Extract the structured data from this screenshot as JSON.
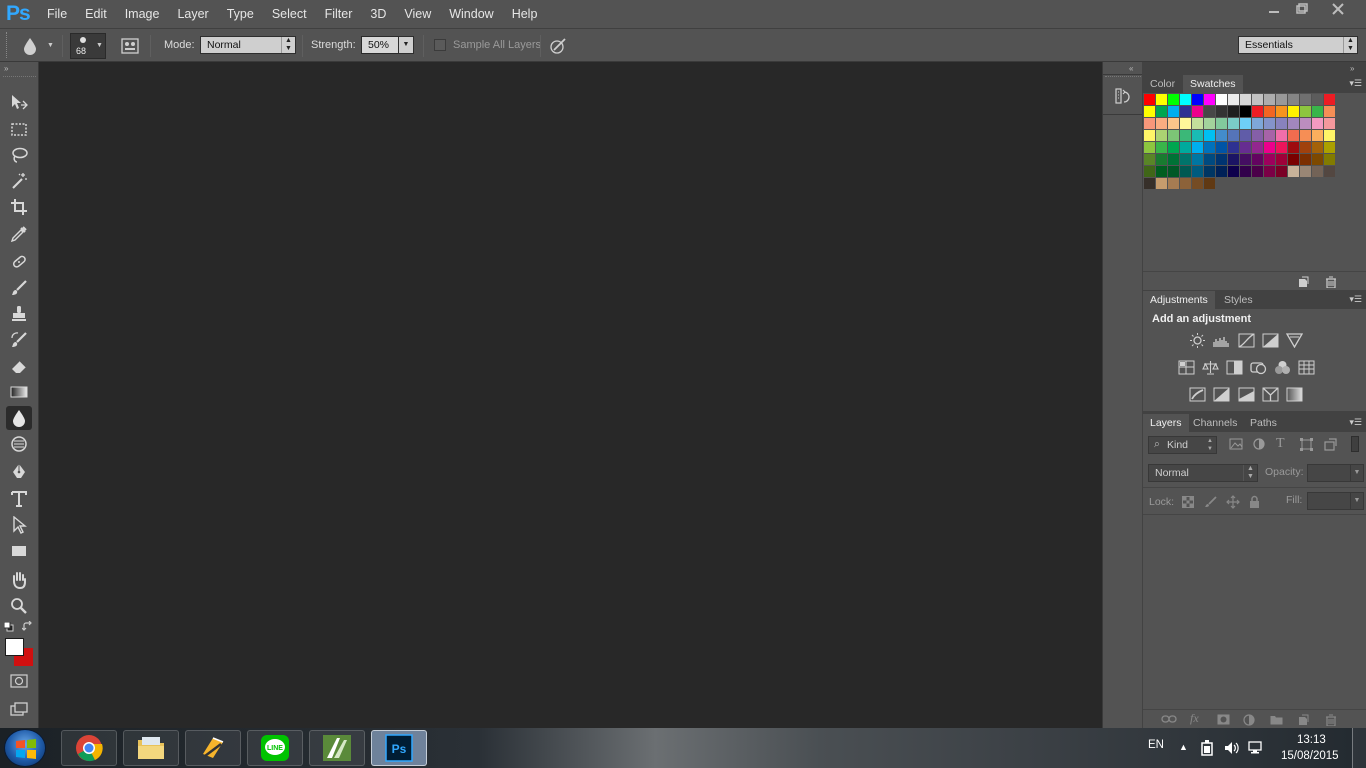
{
  "app": {
    "logo": "Ps"
  },
  "menu": [
    "File",
    "Edit",
    "Image",
    "Layer",
    "Type",
    "Select",
    "Filter",
    "3D",
    "View",
    "Window",
    "Help"
  ],
  "window_controls": [
    "minimize-icon",
    "restore-icon",
    "close-icon"
  ],
  "options": {
    "brush_size": "68",
    "mode_label": "Mode:",
    "mode_value": "Normal",
    "strength_label": "Strength:",
    "strength_value": "50%",
    "sample_all_layers": "Sample All Layers",
    "workspace": "Essentials"
  },
  "tools": [
    "move-tool",
    "rectangular-marquee-tool",
    "lasso-tool",
    "magic-wand-tool",
    "crop-tool",
    "eyedropper-tool",
    "spot-healing-brush-tool",
    "brush-tool",
    "clone-stamp-tool",
    "history-brush-tool",
    "eraser-tool",
    "gradient-tool",
    "blur-tool",
    "dodge-tool",
    "pen-tool",
    "type-tool",
    "path-selection-tool",
    "rectangle-tool",
    "hand-tool",
    "zoom-tool"
  ],
  "colors": {
    "foreground": "#ffffff",
    "background": "#d01010",
    "accent": "#31a8ff"
  },
  "swatches_panel": {
    "tabs": [
      "Color",
      "Swatches"
    ],
    "active": "Swatches",
    "rows": [
      [
        "#ff0000",
        "#ffff00",
        "#00ff00",
        "#00ffff",
        "#0000ff",
        "#ff00ff",
        "#ffffff",
        "#ebebeb",
        "#d6d6d6",
        "#c2c2c2",
        "#adadad",
        "#999999",
        "#858585",
        "#707070",
        "#5c5c5c",
        "#ed1c24"
      ],
      [
        "#ffff00",
        "#00a650",
        "#00aeef",
        "#2e3192",
        "#ec008c",
        "#474747",
        "#333333",
        "#1f1f1f",
        "#000000",
        "#ed1c24",
        "#f26522",
        "#f7941d",
        "#fff200",
        "#8dc63f",
        "#39b54a",
        "#f68e56"
      ],
      [
        "#f7977a",
        "#f9ad81",
        "#fdc68a",
        "#fff79a",
        "#c4df9b",
        "#a3d39c",
        "#82ca9d",
        "#7bcdc8",
        "#6ecff6",
        "#7ea7d8",
        "#8493ca",
        "#8882be",
        "#a187be",
        "#bc8dbf",
        "#f49ac2",
        "#f6989d"
      ],
      [
        "#fff568",
        "#acd372",
        "#7cc576",
        "#3bb878",
        "#1abbb4",
        "#00bff3",
        "#438ccb",
        "#5574b9",
        "#605ca8",
        "#855fa8",
        "#a763a8",
        "#f06eaa",
        "#f26c4f",
        "#f68e55",
        "#fbaf5d",
        "#fff467"
      ],
      [
        "#8dc63f",
        "#39b54a",
        "#00a650",
        "#00a99d",
        "#00aeef",
        "#0072bc",
        "#0054a6",
        "#2e3192",
        "#662d91",
        "#92278f",
        "#ec008c",
        "#ed145b",
        "#9e0b0f",
        "#a0410d",
        "#a36209",
        "#aba000"
      ],
      [
        "#598527",
        "#197b30",
        "#007236",
        "#00746b",
        "#0076a3",
        "#004a80",
        "#003471",
        "#1b1464",
        "#440e62",
        "#630460",
        "#9e005d",
        "#9e0039",
        "#790000",
        "#7b2e00",
        "#7d4900",
        "#827b00"
      ],
      [
        "#406618",
        "#005e20",
        "#005826",
        "#005952",
        "#005b7f",
        "#003663",
        "#002157",
        "#0d004c",
        "#32004b",
        "#4b0049",
        "#7b0046",
        "#7a0026",
        "#c7b299",
        "#998675",
        "#736357",
        "#534741"
      ],
      [
        "#37302a",
        "#c69c6d",
        "#a67c52",
        "#8c6239",
        "#754c24",
        "#603913"
      ]
    ]
  },
  "adjustments_panel": {
    "tabs": [
      "Adjustments",
      "Styles"
    ],
    "active": "Adjustments",
    "heading": "Add an adjustment"
  },
  "layers_panel": {
    "tabs": [
      "Layers",
      "Channels",
      "Paths"
    ],
    "active": "Layers",
    "filter_kind": "Kind",
    "blend_mode": "Normal",
    "opacity_label": "Opacity:",
    "lock_label": "Lock:",
    "fill_label": "Fill:"
  },
  "taskbar": {
    "apps": [
      "chrome-icon",
      "explorer-icon",
      "app-icon",
      "line-icon",
      "app-icon-2",
      "photoshop-icon"
    ],
    "language": "EN",
    "time": "13:13",
    "date": "15/08/2015"
  }
}
